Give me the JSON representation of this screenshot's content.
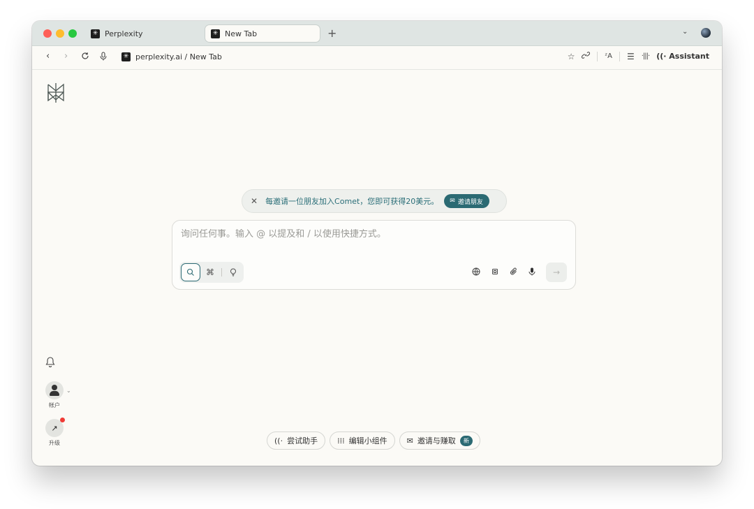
{
  "window": {
    "traffic_lights": [
      "close",
      "minimize",
      "zoom"
    ]
  },
  "tabs": [
    {
      "label": "Perplexity",
      "active": false,
      "favicon": "perplexity-icon"
    },
    {
      "label": "New Tab",
      "active": true,
      "favicon": "perplexity-icon"
    }
  ],
  "tabstrip": {
    "new_tab": "+",
    "dropdown": "⌄"
  },
  "addressbar": {
    "back": "‹",
    "forward": "›",
    "reload": "C",
    "url": "perplexity.ai / New Tab",
    "assistant_label": "Assistant"
  },
  "banner": {
    "text": "每邀请一位朋友加入Comet，您即可获得20美元。",
    "button_label": "邀请朋友"
  },
  "search": {
    "placeholder": "询问任何事。输入 @ 以提及和 / 以使用快捷方式。",
    "modes": [
      "search",
      "research",
      "labs"
    ],
    "active_mode": "search"
  },
  "sidebar": {
    "account_label": "帐户",
    "upgrade_label": "升级"
  },
  "bottom_actions": [
    {
      "label": "尝试助手",
      "icon": "assistant-icon"
    },
    {
      "label": "编辑小组件",
      "icon": "grid-icon"
    },
    {
      "label": "邀请与赚取",
      "icon": "mail-icon",
      "badge": "新"
    }
  ],
  "colors": {
    "accent": "#2b6a73",
    "notification": "#ef3b36"
  }
}
